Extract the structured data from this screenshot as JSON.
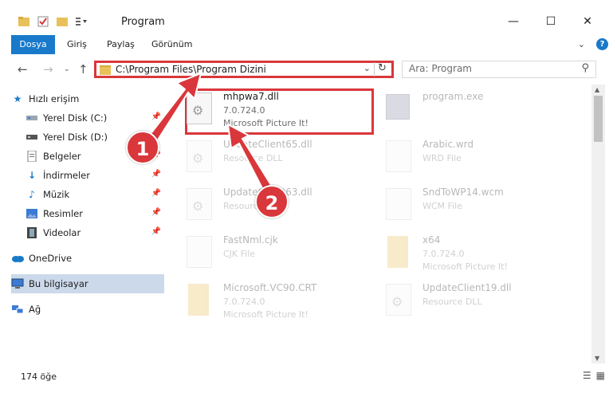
{
  "window": {
    "title": "Program"
  },
  "ribbon": {
    "tabs": [
      "Dosya",
      "Giriş",
      "Paylaş",
      "Görünüm"
    ]
  },
  "address": {
    "path": "C:\\Program Files\\Program Dizini"
  },
  "search": {
    "placeholder": "Ara: Program"
  },
  "sidebar": {
    "items": [
      {
        "label": "Hızlı erişim",
        "icon": "star-icon"
      },
      {
        "label": "Yerel Disk (C:)",
        "icon": "drive-icon",
        "pinned": true
      },
      {
        "label": "Yerel Disk (D:)",
        "icon": "drive-icon",
        "pinned": true
      },
      {
        "label": "Belgeler",
        "icon": "document-icon",
        "pinned": true
      },
      {
        "label": "İndirmeler",
        "icon": "download-icon",
        "pinned": true
      },
      {
        "label": "Müzik",
        "icon": "music-icon",
        "pinned": true
      },
      {
        "label": "Resimler",
        "icon": "pictures-icon",
        "pinned": true
      },
      {
        "label": "Videolar",
        "icon": "video-icon",
        "pinned": true
      },
      {
        "label": "OneDrive",
        "icon": "cloud-icon"
      },
      {
        "label": "Bu bilgisayar",
        "icon": "computer-icon",
        "selected": true
      },
      {
        "label": "Ağ",
        "icon": "network-icon"
      }
    ]
  },
  "files": [
    {
      "name": "mhpwa7.dll",
      "line2": "7.0.724.0",
      "line3": "Microsoft Picture It!",
      "dim": false,
      "highlighted": true
    },
    {
      "name": "program.exe",
      "line2": "",
      "line3": "",
      "dim": true
    },
    {
      "name": "UpdateClient65.dll",
      "line2": "Resource DLL",
      "line3": "",
      "dim": true
    },
    {
      "name": "Arabic.wrd",
      "line2": "WRD File",
      "line3": "",
      "dim": true
    },
    {
      "name": "UpdateClient63.dll",
      "line2": "Resource DLL",
      "line3": "",
      "dim": true
    },
    {
      "name": "SndToWP14.wcm",
      "line2": "WCM File",
      "line3": "",
      "dim": true
    },
    {
      "name": "FastNml.cjk",
      "line2": "CJK File",
      "line3": "",
      "dim": true
    },
    {
      "name": "x64",
      "line2": "7.0.724.0",
      "line3": "Microsoft Picture It!",
      "dim": true
    },
    {
      "name": "Microsoft.VC90.CRT",
      "line2": "7.0.724.0",
      "line3": "Microsoft Picture It!",
      "dim": true
    },
    {
      "name": "UpdateClient19.dll",
      "line2": "Resource DLL",
      "line3": "",
      "dim": true
    }
  ],
  "status": {
    "count": "174 öğe"
  },
  "annotations": {
    "badge1": "1",
    "badge2": "2",
    "accent": "#d9373b"
  }
}
